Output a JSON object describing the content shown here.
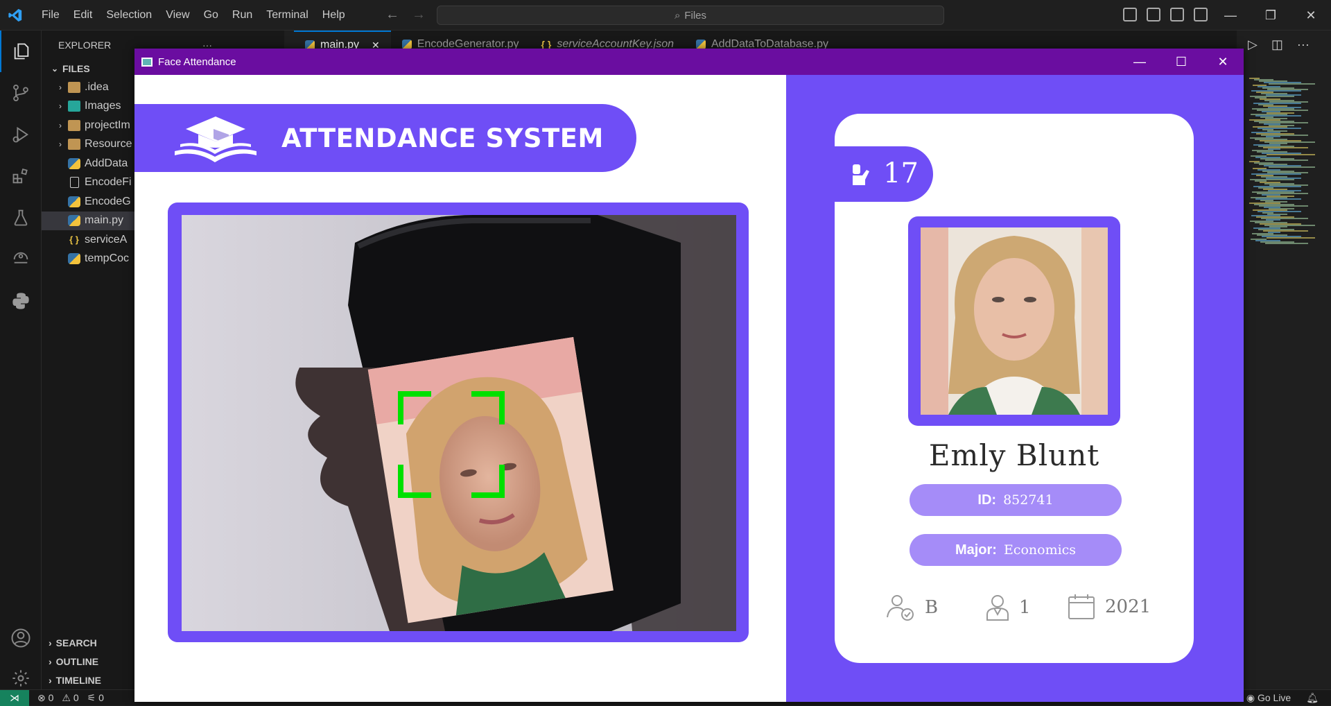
{
  "vscode": {
    "menu": [
      "File",
      "Edit",
      "Selection",
      "View",
      "Go",
      "Run",
      "Terminal",
      "Help"
    ],
    "command_center": "Files",
    "explorer": {
      "title": "EXPLORER",
      "root": "FILES",
      "items": [
        {
          "label": ".idea",
          "type": "folder",
          "expandable": true
        },
        {
          "label": "Images",
          "type": "img",
          "expandable": true
        },
        {
          "label": "projectIm",
          "type": "folder",
          "expandable": true
        },
        {
          "label": "Resource",
          "type": "folder",
          "expandable": true
        },
        {
          "label": "AddData",
          "type": "py",
          "expandable": false
        },
        {
          "label": "EncodeFi",
          "type": "file",
          "expandable": false
        },
        {
          "label": "EncodeG",
          "type": "py",
          "expandable": false
        },
        {
          "label": "main.py",
          "type": "py",
          "expandable": false,
          "selected": true
        },
        {
          "label": "serviceA",
          "type": "json",
          "expandable": false
        },
        {
          "label": "tempCoc",
          "type": "py",
          "expandable": false
        }
      ],
      "sections": [
        "SEARCH",
        "OUTLINE",
        "TIMELINE"
      ]
    },
    "tabs": [
      {
        "label": "main.py",
        "icon": "python-icon",
        "active": true
      },
      {
        "label": "EncodeGenerator.py",
        "icon": "python-icon",
        "active": false
      },
      {
        "label": "serviceAccountKey.json",
        "icon": "json-icon",
        "active": false
      },
      {
        "label": "AddDataToDatabase.py",
        "icon": "python-icon",
        "active": false
      }
    ],
    "status": {
      "errors": "0",
      "warnings": "0",
      "ports": "0",
      "go_live": "Go Live"
    }
  },
  "app": {
    "window_title": "Face Attendance",
    "banner_title": "ATTENDANCE SYSTEM",
    "colors": {
      "primary": "#6f4ef6",
      "pill": "#a58cf8",
      "titlebar": "#6a0da0",
      "box": "#00e000"
    },
    "student": {
      "total_attendance": "17",
      "name": "Emly Blunt",
      "id_label": "ID:",
      "id": "852741",
      "major_label": "Major:",
      "major": "Economics",
      "standing": "B",
      "year": "1",
      "starting_year": "2021"
    }
  }
}
